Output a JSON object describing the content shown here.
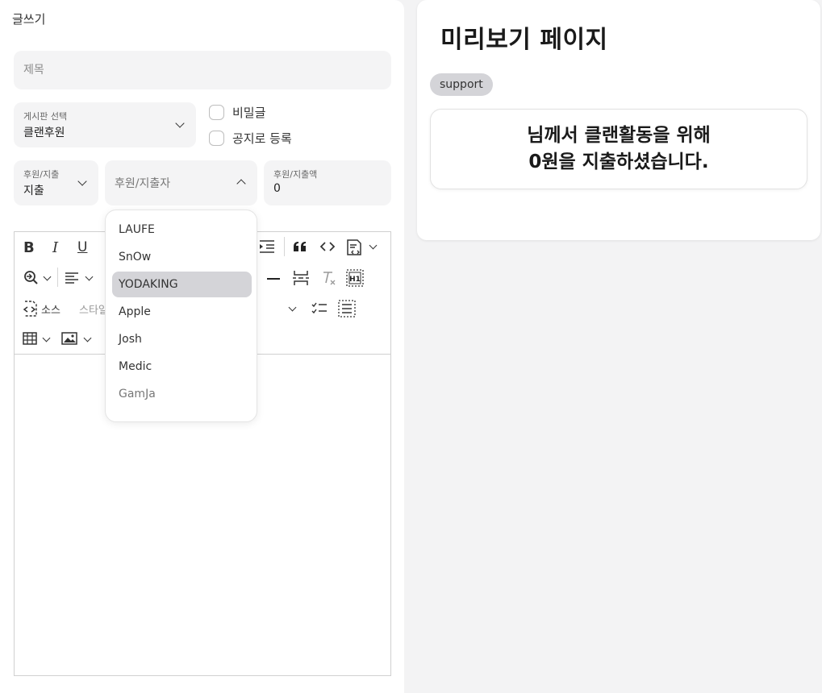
{
  "form": {
    "heading": "글쓰기",
    "title_placeholder": "제목",
    "board": {
      "label": "게시판 선택",
      "value": "클랜후원"
    },
    "secret_label": "비밀글",
    "notice_label": "공지로 등록",
    "type": {
      "label": "후원/지출",
      "value": "지출"
    },
    "person": {
      "placeholder": "후원/지출자"
    },
    "amount": {
      "label": "후원/지출액",
      "value": "0"
    }
  },
  "dropdown": {
    "options": [
      "LAUFE",
      "SnOw",
      "YODAKING",
      "Apple",
      "Josh",
      "Medic",
      "GamJa"
    ],
    "highlighted": "YODAKING"
  },
  "toolbar": {
    "bold": "B",
    "italic": "I",
    "underline": "U",
    "source_label": "소스",
    "style_label": "스타일",
    "icons": [
      "bold-icon",
      "italic-icon",
      "underline-icon",
      "outdent-icon",
      "blockquote-icon",
      "code-icon",
      "insert-template-icon",
      "find-replace-icon",
      "align-icon",
      "horizontal-line-icon",
      "page-break-icon",
      "remove-format-icon",
      "heading-icon",
      "source-icon",
      "todo-list-icon",
      "show-blocks-icon",
      "table-icon",
      "image-icon"
    ]
  },
  "preview": {
    "title": "미리보기 페이지",
    "tag": "support",
    "message_line1": "님께서 클랜활동을 위해",
    "message_line2": "0원을 지출하셨습니다."
  },
  "colors": {
    "background": "#f3f3f4",
    "field": "#f4f4f5",
    "selected": "#d4d4d8"
  }
}
